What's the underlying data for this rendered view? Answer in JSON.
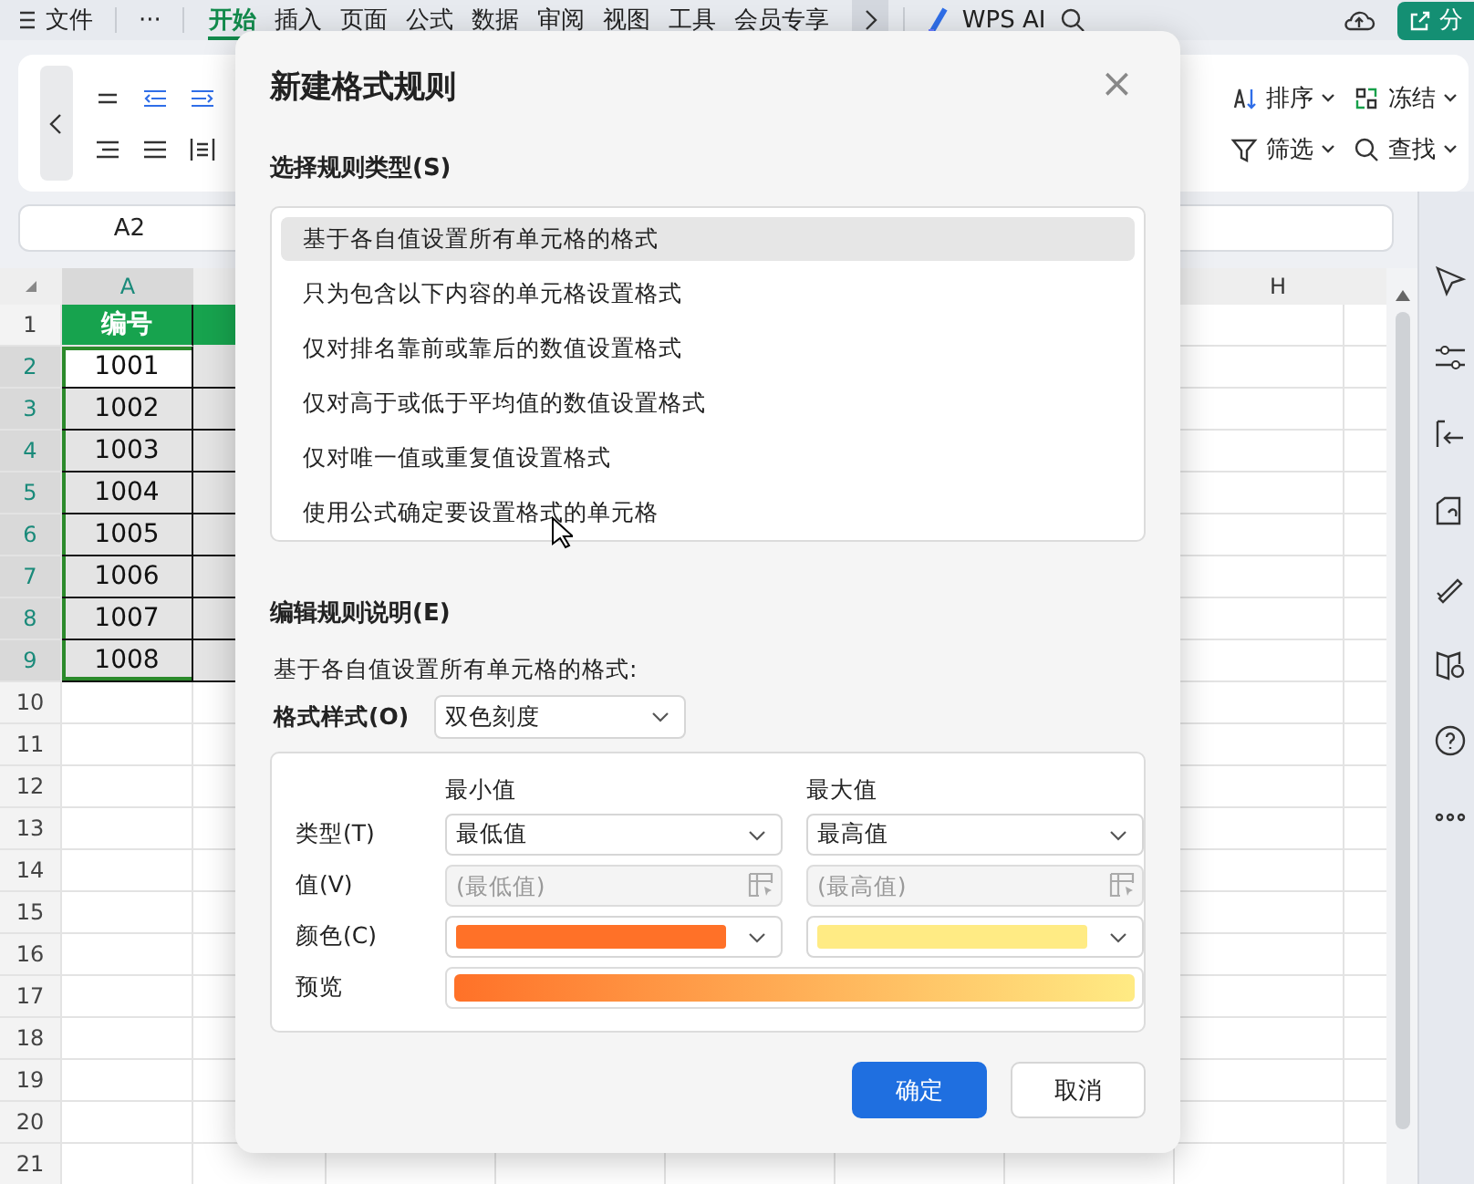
{
  "topbar": {
    "file_menu": "文件",
    "more": "···",
    "tabs": [
      {
        "label": "开始",
        "selected": true
      },
      {
        "label": "插入",
        "selected": false
      },
      {
        "label": "页面",
        "selected": false
      },
      {
        "label": "公式",
        "selected": false
      },
      {
        "label": "数据",
        "selected": false
      },
      {
        "label": "审阅",
        "selected": false
      },
      {
        "label": "视图",
        "selected": false
      },
      {
        "label": "工具",
        "selected": false
      },
      {
        "label": "会员专享",
        "selected": false
      }
    ],
    "ai_button": "WPS AI",
    "share_button": "分"
  },
  "ribbon": {
    "tools": [
      {
        "label": "排序",
        "kind": "sort"
      },
      {
        "label": "冻结",
        "kind": "freeze"
      },
      {
        "label": "筛选",
        "kind": "filter"
      },
      {
        "label": "查找",
        "kind": "find"
      }
    ]
  },
  "name_box": "A2",
  "grid": {
    "column_a": "A",
    "column_h": "H",
    "rows": [
      {
        "number": "1",
        "kind": "header",
        "selected": false,
        "value": "编号"
      },
      {
        "number": "2",
        "kind": "data",
        "selected": true,
        "active": true,
        "value": "1001"
      },
      {
        "number": "3",
        "kind": "data",
        "selected": true,
        "active": false,
        "value": "1002"
      },
      {
        "number": "4",
        "kind": "data",
        "selected": true,
        "active": false,
        "value": "1003"
      },
      {
        "number": "5",
        "kind": "data",
        "selected": true,
        "active": false,
        "value": "1004"
      },
      {
        "number": "6",
        "kind": "data",
        "selected": true,
        "active": false,
        "value": "1005"
      },
      {
        "number": "7",
        "kind": "data",
        "selected": true,
        "active": false,
        "value": "1006"
      },
      {
        "number": "8",
        "kind": "data",
        "selected": true,
        "active": false,
        "value": "1007"
      },
      {
        "number": "9",
        "kind": "data",
        "selected": true,
        "active": false,
        "value": "1008"
      },
      {
        "number": "10",
        "kind": "blank",
        "selected": false
      },
      {
        "number": "11",
        "kind": "blank",
        "selected": false
      },
      {
        "number": "12",
        "kind": "blank",
        "selected": false
      },
      {
        "number": "13",
        "kind": "blank",
        "selected": false
      },
      {
        "number": "14",
        "kind": "blank",
        "selected": false
      },
      {
        "number": "15",
        "kind": "blank",
        "selected": false
      },
      {
        "number": "16",
        "kind": "blank",
        "selected": false
      },
      {
        "number": "17",
        "kind": "blank",
        "selected": false
      },
      {
        "number": "18",
        "kind": "blank",
        "selected": false
      },
      {
        "number": "19",
        "kind": "blank",
        "selected": false
      },
      {
        "number": "20",
        "kind": "blank",
        "selected": false
      },
      {
        "number": "21",
        "kind": "blank",
        "selected": false
      }
    ]
  },
  "dialog": {
    "title": "新建格式规则",
    "close": "×",
    "rule_type_heading": "选择规则类型(S)",
    "rule_types": [
      {
        "label": "基于各自值设置所有单元格的格式",
        "selected": true
      },
      {
        "label": "只为包含以下内容的单元格设置格式",
        "selected": false
      },
      {
        "label": "仅对排名靠前或靠后的数值设置格式",
        "selected": false
      },
      {
        "label": "仅对高于或低于平均值的数值设置格式",
        "selected": false
      },
      {
        "label": "仅对唯一值或重复值设置格式",
        "selected": false
      },
      {
        "label": "使用公式确定要设置格式的单元格",
        "selected": false
      }
    ],
    "description_heading": "编辑规则说明(E)",
    "description": "基于各自值设置所有单元格的格式:",
    "style_label": "格式样式(O)",
    "style_value": "双色刻度",
    "minimum": {
      "heading": "最小值",
      "type": "最低值",
      "placeholder": "(最低值)",
      "disabled": true,
      "color": "#ff7128"
    },
    "maximum": {
      "heading": "最大值",
      "type": "最高值",
      "placeholder": "(最高值)",
      "disabled": true,
      "color": "#ffeb84"
    },
    "type_label": "类型(T)",
    "value_label": "值(V)",
    "color_label": "颜色(C)",
    "preview_label": "预览",
    "buttons": [
      {
        "label": "确定",
        "kind": "primary"
      },
      {
        "label": "取消",
        "kind": "secondary"
      }
    ]
  }
}
